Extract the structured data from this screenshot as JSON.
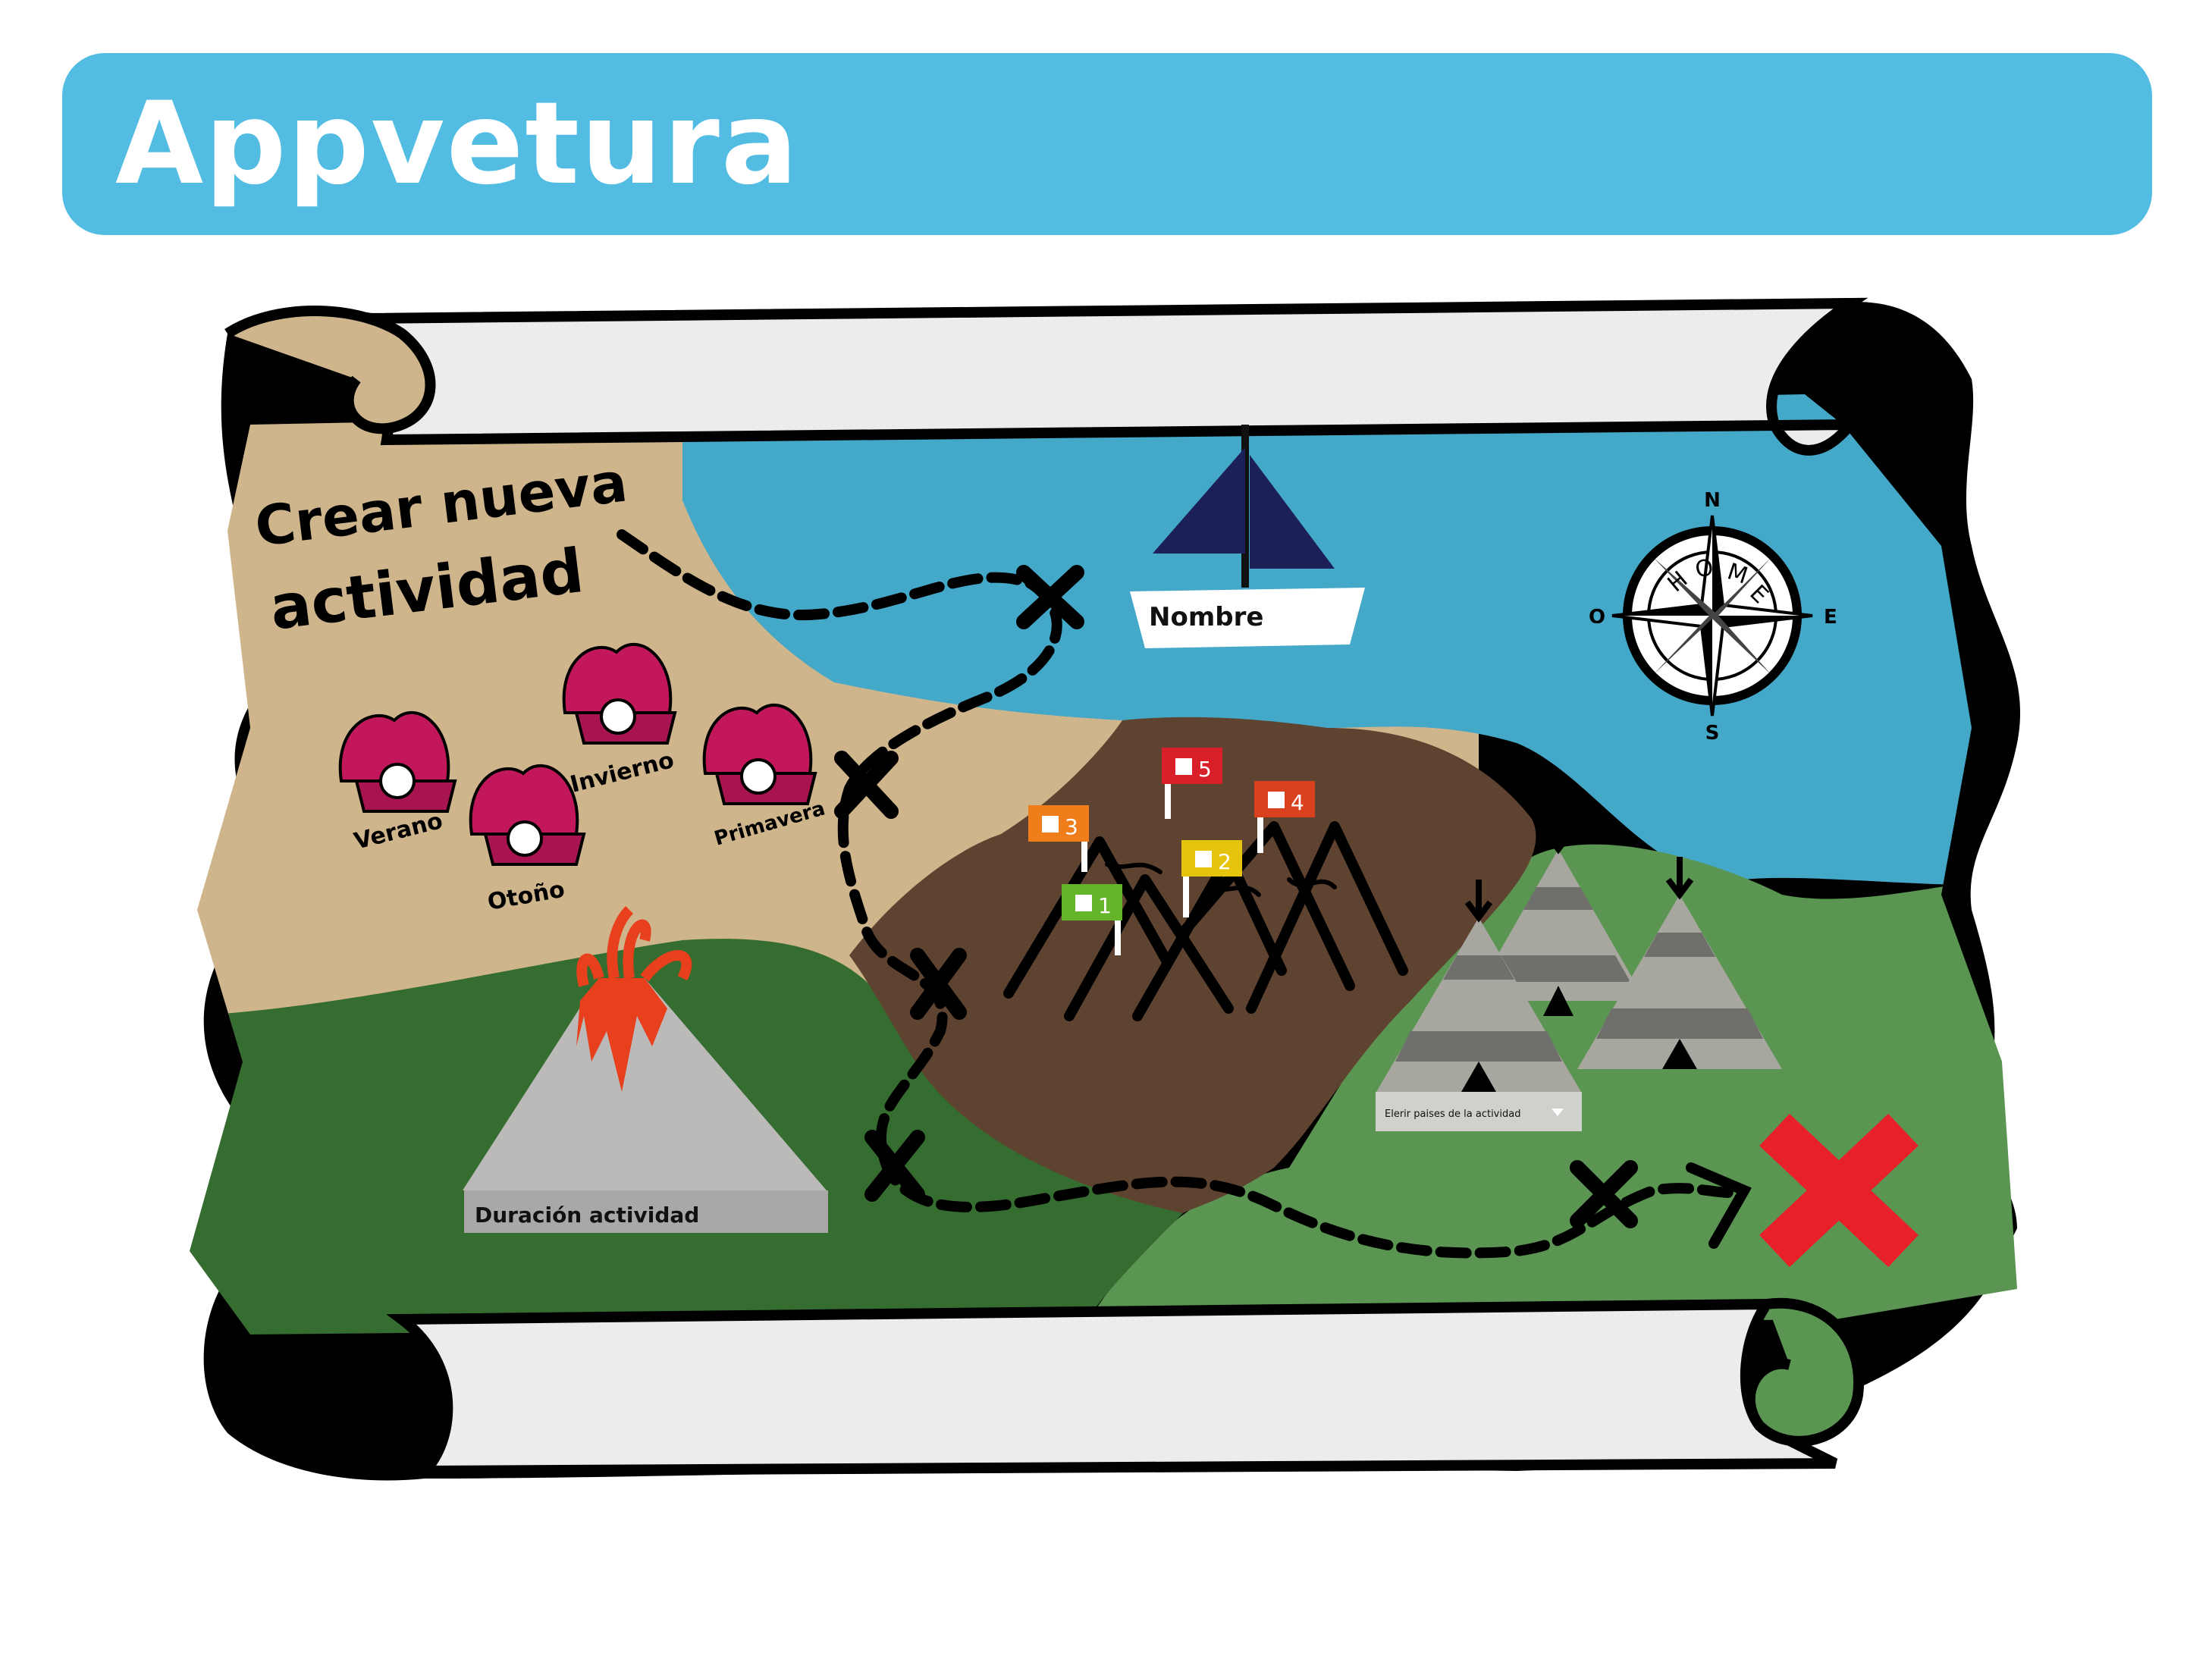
{
  "header": {
    "title": "Appvetura",
    "color": "#52bce3"
  },
  "map": {
    "create_activity_line1": "Crear nueva",
    "create_activity_line2": "actividad",
    "boat_label": "Nombre",
    "volcano_label": "Duración actividad",
    "countries_select_label": "Elerir paises de la actividad",
    "seasons": [
      "Verano",
      "Otoño",
      "Invierno",
      "Primavera"
    ],
    "flags": [
      {
        "number": "1",
        "color": "#64b52a"
      },
      {
        "number": "2",
        "color": "#e6c40e"
      },
      {
        "number": "3",
        "color": "#ef7d1a"
      },
      {
        "number": "4",
        "color": "#d9401e"
      },
      {
        "number": "5",
        "color": "#d81f2a"
      }
    ],
    "compass": {
      "n": "N",
      "s": "S",
      "e": "E",
      "w": "O",
      "ring": [
        "H",
        "O",
        "M",
        "E"
      ]
    },
    "goal_marker_color": "#e8202a"
  }
}
